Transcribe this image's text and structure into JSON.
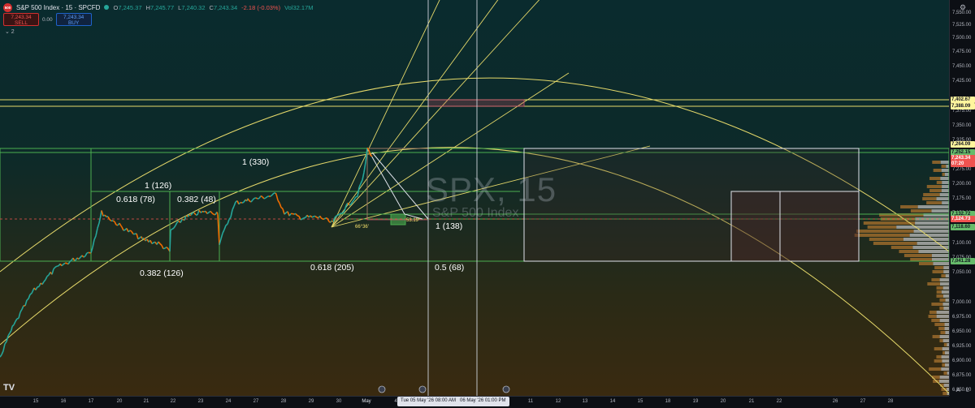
{
  "header": {
    "logo_text": "500",
    "title": "S&P 500 Index · 15 · SPCFD",
    "open_key": "O",
    "open_val": "7,245.37",
    "high_key": "H",
    "high_val": "7,245.77",
    "low_key": "L",
    "low_val": "7,240.32",
    "close_key": "C",
    "close_val": "7,243.34",
    "change": "-2.18 (-0.03%)",
    "volume": "Vol32.17M"
  },
  "trade": {
    "sell_price": "7,243.34",
    "sell_label": "SELL",
    "buy_price": "7,243.34",
    "buy_label": "BUY",
    "spread": "0.00"
  },
  "indicator_toggle": "⌄ 2",
  "watermark": {
    "symbol": "SPX, 15",
    "name": "S&P 500 Index"
  },
  "annotations": {
    "a330": "1 (330)",
    "a126": "1 (126)",
    "a0618_78": "0.618 (78)",
    "a0382_48": "0.382 (48)",
    "a0382_126": "0.382 (126)",
    "a0618_205": "0.618 (205)",
    "a138": "1 (138)",
    "a05_68": "0.5 (68)",
    "angle1": "66°36'",
    "angle2": "53.19°"
  },
  "price_axis": {
    "ticks": [
      "7,550.00",
      "7,525.00",
      "7,500.00",
      "7,475.00",
      "7,450.00",
      "7,425.00",
      "7,375.00",
      "7,350.00",
      "7,325.00",
      "7,300.00",
      "7,275.00",
      "7,200.00",
      "7,175.00",
      "7,150.00",
      "7,100.00",
      "7,075.00",
      "7,050.00",
      "7,000.00",
      "6,975.00",
      "6,950.00",
      "6,925.00",
      "6,900.00",
      "6,875.00",
      "6,850.00",
      "6,825.00",
      "6,800.00"
    ],
    "labels": [
      "7,402.67",
      "7,388.09",
      "7,264.09",
      "7,252.15",
      "7,243.34",
      "07:20",
      "7,132.72",
      "7,124.73",
      "7,118.60",
      "7,041.28"
    ],
    "letter_a": "A",
    "letter_l": "L"
  },
  "time_axis": {
    "ticks": [
      "15",
      "16",
      "17",
      "20",
      "21",
      "22",
      "23",
      "24",
      "27",
      "28",
      "29",
      "30",
      "May",
      "4",
      "11",
      "12",
      "13",
      "14",
      "15",
      "18",
      "19",
      "20",
      "21",
      "22",
      "26",
      "27",
      "28"
    ],
    "badge1": "Tue 05 May '26   08:00 AM",
    "badge2": "06 May '26   01:00 PM"
  },
  "tv_logo": "TV",
  "colors": {
    "candle_up": "#26a69a",
    "candle_down": "#ef6c00",
    "fib_green": "#4caf50",
    "gann_yellow": "#e6d96a",
    "box_white": "#e0e3eb",
    "current_price": "#ef5350"
  }
}
